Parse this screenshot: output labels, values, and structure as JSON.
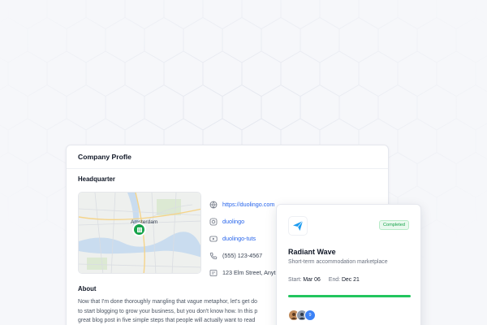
{
  "profile": {
    "title": "Company Profle",
    "headquarter_title": "Headquarter",
    "map_label": "Amsterdam",
    "links": [
      {
        "icon": "globe-icon",
        "text": "https://duolingo.com"
      },
      {
        "icon": "instagram-icon",
        "text": "duolingo"
      },
      {
        "icon": "youtube-icon",
        "text": "duolingo-tuts"
      },
      {
        "icon": "phone-icon",
        "text": "(555) 123-4567"
      },
      {
        "icon": "address-icon",
        "text": "123 Elm Street, Anyt"
      }
    ],
    "about_title": "About",
    "about_lines": [
      "Now that I'm done thoroughly mangling that vague metaphor, let's get do",
      "to start blogging to grow your business, but you don't know how. In this p",
      "great blog post in five simple steps that people will actually want to read"
    ]
  },
  "project": {
    "icon": "paper-plane-icon",
    "status": "Completed",
    "name": "Radiant Wave",
    "description": "Short-term accommodation marketplace",
    "start_label": "Start:",
    "start_date": "Mar 06",
    "end_label": "End:",
    "end_date": "Dec 21",
    "progress": 1.0,
    "members_more": "9"
  },
  "colors": {
    "accent": "#2563eb",
    "success": "#22c55e",
    "pin": "#16a34a"
  }
}
